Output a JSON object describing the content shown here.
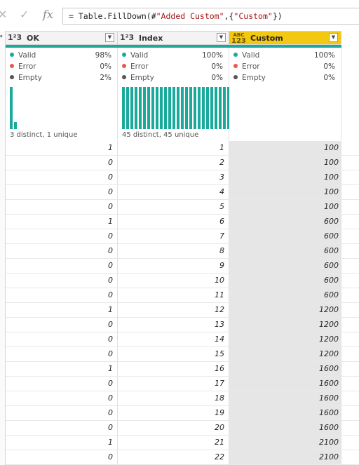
{
  "formula_bar": {
    "cancel_icon": "close-icon",
    "commit_icon": "check-icon",
    "fx_label": "fx",
    "formula_prefix": "= Table.FillDown(#",
    "formula_str1": "\"Added Custom\"",
    "formula_mid": ",{",
    "formula_str2": "\"Custom\"",
    "formula_suffix": "})"
  },
  "columns": [
    {
      "type_icon": "1²3",
      "name": "OK",
      "valid_label": "Valid",
      "valid_pct": "98%",
      "error_label": "Error",
      "error_pct": "0%",
      "empty_label": "Empty",
      "empty_pct": "2%",
      "distinct": "3 distinct, 1 unique",
      "distribution": [
        1.0,
        0.17
      ]
    },
    {
      "type_icon": "1²3",
      "name": "Index",
      "valid_label": "Valid",
      "valid_pct": "100%",
      "error_label": "Error",
      "error_pct": "0%",
      "empty_label": "Empty",
      "empty_pct": "0%",
      "distinct": "45 distinct, 45 unique",
      "distribution": [
        1,
        1,
        1,
        1,
        1,
        1,
        1,
        1,
        1,
        1,
        1,
        1,
        1,
        1,
        1,
        1,
        1,
        1,
        1,
        1,
        1,
        1,
        1,
        1,
        1,
        1,
        1,
        1,
        1,
        1,
        1,
        1,
        1,
        1,
        1,
        1,
        1,
        1,
        1,
        1,
        1,
        1,
        1,
        1,
        1
      ]
    },
    {
      "type_icon_top": "ABC",
      "type_icon_bottom": "123",
      "name": "Custom",
      "valid_label": "Valid",
      "valid_pct": "100%",
      "error_label": "Error",
      "error_pct": "0%",
      "empty_label": "Empty",
      "empty_pct": "0%"
    }
  ],
  "colors": {
    "valid": "#1aaa9c",
    "error": "#e8574d",
    "empty": "#555555",
    "selected_header": "#f2c811"
  },
  "rows": [
    {
      "ok": "1",
      "index": "1",
      "custom": "100"
    },
    {
      "ok": "0",
      "index": "2",
      "custom": "100"
    },
    {
      "ok": "0",
      "index": "3",
      "custom": "100"
    },
    {
      "ok": "0",
      "index": "4",
      "custom": "100"
    },
    {
      "ok": "0",
      "index": "5",
      "custom": "100"
    },
    {
      "ok": "1",
      "index": "6",
      "custom": "600"
    },
    {
      "ok": "0",
      "index": "7",
      "custom": "600"
    },
    {
      "ok": "0",
      "index": "8",
      "custom": "600"
    },
    {
      "ok": "0",
      "index": "9",
      "custom": "600"
    },
    {
      "ok": "0",
      "index": "10",
      "custom": "600"
    },
    {
      "ok": "0",
      "index": "11",
      "custom": "600"
    },
    {
      "ok": "1",
      "index": "12",
      "custom": "1200"
    },
    {
      "ok": "0",
      "index": "13",
      "custom": "1200"
    },
    {
      "ok": "0",
      "index": "14",
      "custom": "1200"
    },
    {
      "ok": "0",
      "index": "15",
      "custom": "1200"
    },
    {
      "ok": "1",
      "index": "16",
      "custom": "1600"
    },
    {
      "ok": "0",
      "index": "17",
      "custom": "1600"
    },
    {
      "ok": "0",
      "index": "18",
      "custom": "1600"
    },
    {
      "ok": "0",
      "index": "19",
      "custom": "1600"
    },
    {
      "ok": "0",
      "index": "20",
      "custom": "1600"
    },
    {
      "ok": "1",
      "index": "21",
      "custom": "2100"
    },
    {
      "ok": "0",
      "index": "22",
      "custom": "2100"
    }
  ]
}
